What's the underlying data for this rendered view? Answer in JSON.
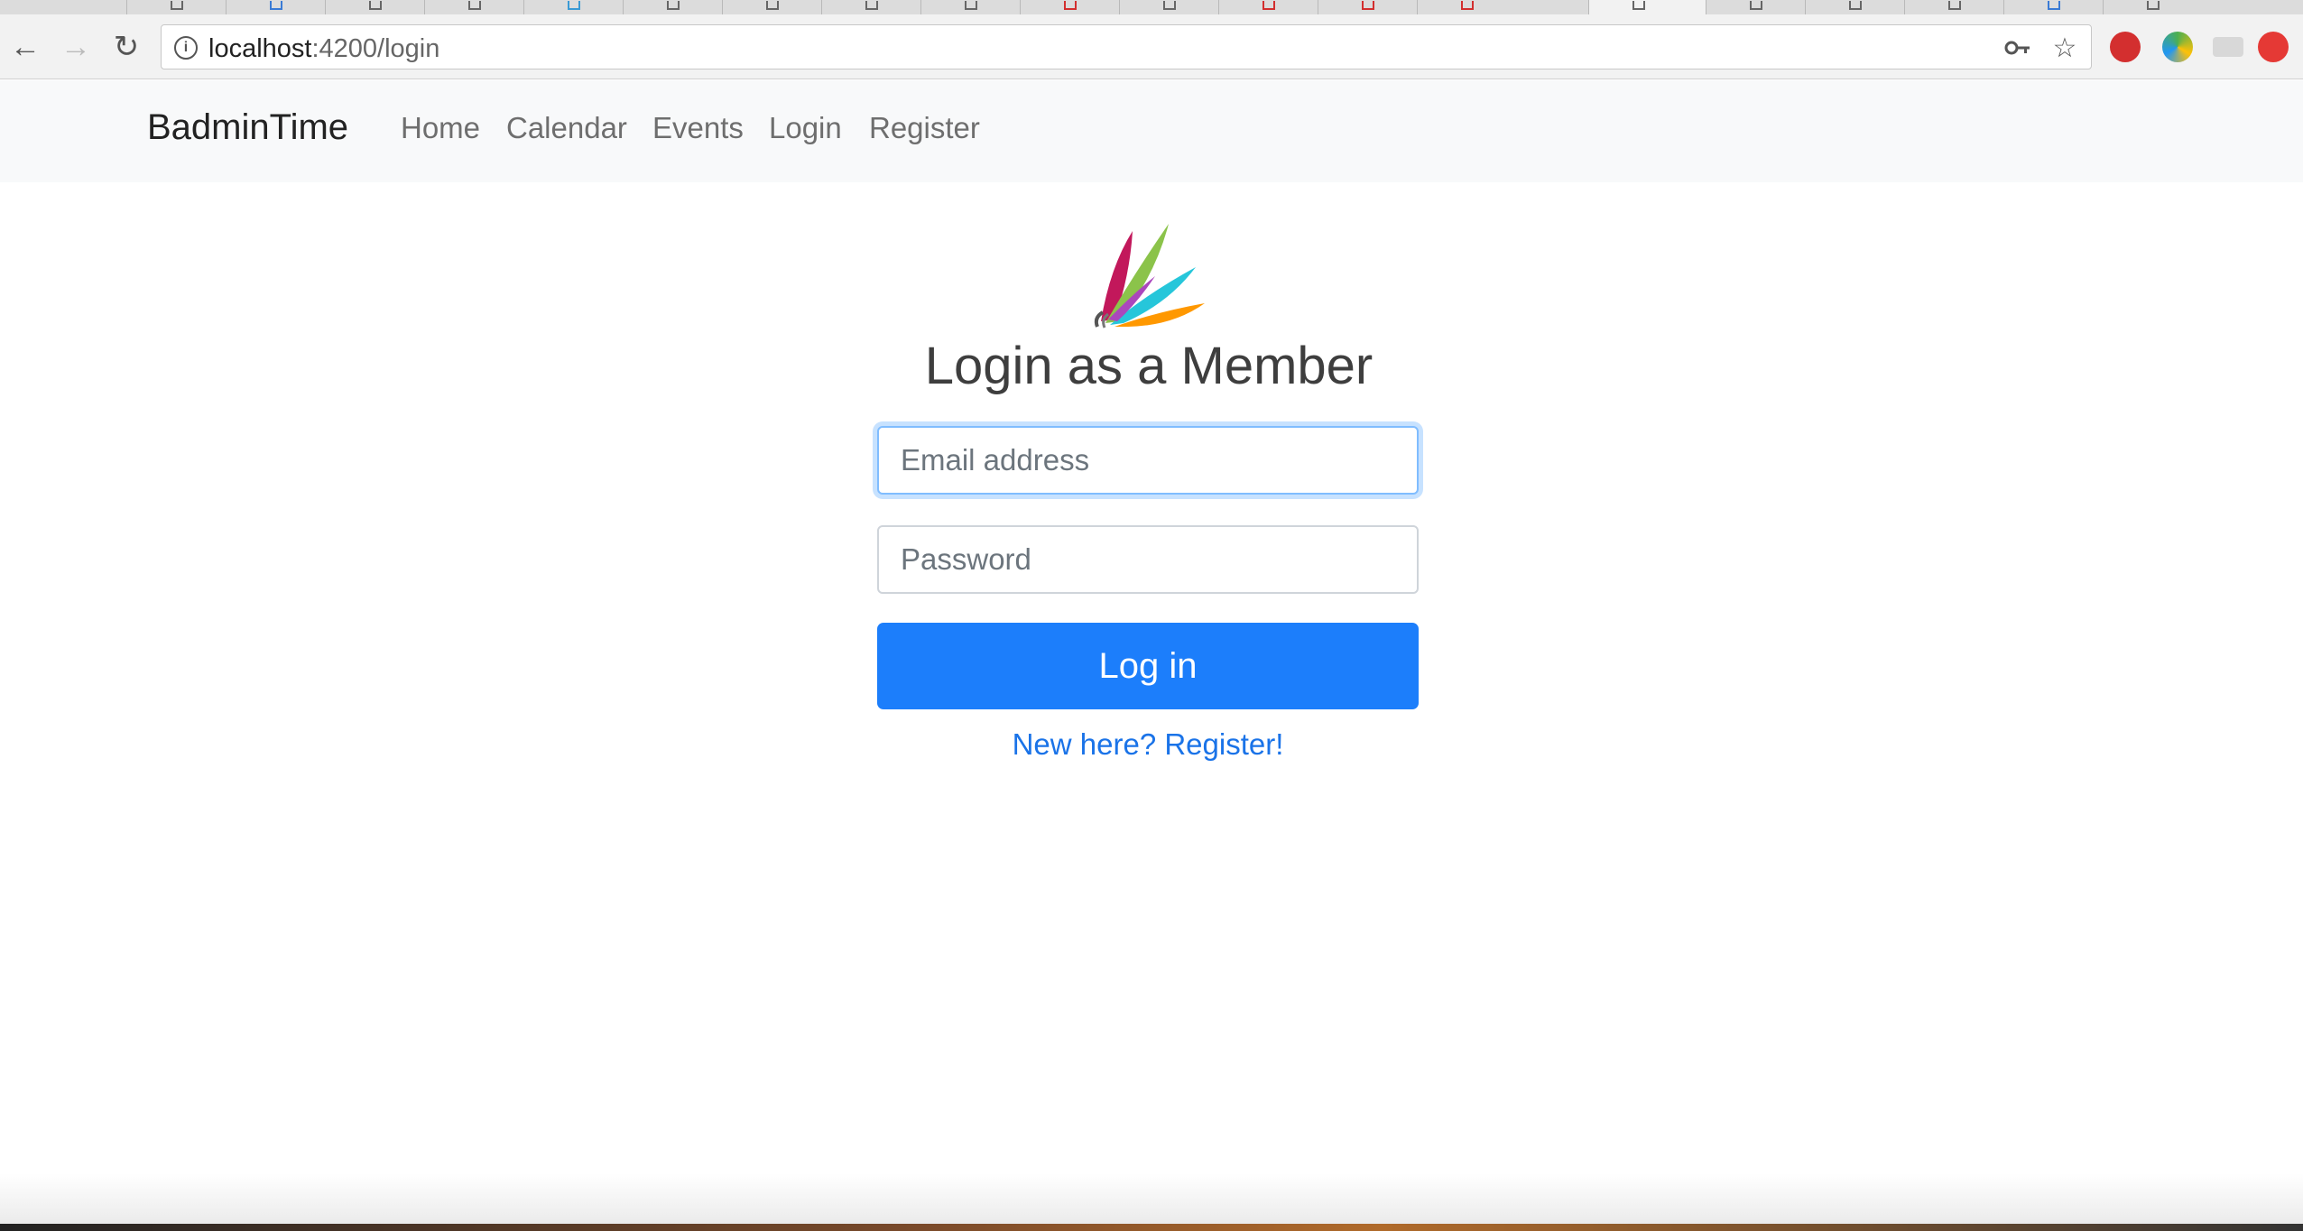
{
  "browser": {
    "url_host": "localhost",
    "url_path": ":4200/login",
    "tab_count": 20
  },
  "navbar": {
    "brand": "BadminTime",
    "links": [
      "Home",
      "Calendar",
      "Events",
      "Login",
      "Register"
    ]
  },
  "login": {
    "title": "Login as a Member",
    "email_placeholder": "Email address",
    "password_placeholder": "Password",
    "submit_label": "Log in",
    "register_link": "New here? Register!"
  },
  "colors": {
    "primary": "#1c7efb",
    "link": "#1a73e8",
    "navbar_bg": "#f8f9fa"
  }
}
